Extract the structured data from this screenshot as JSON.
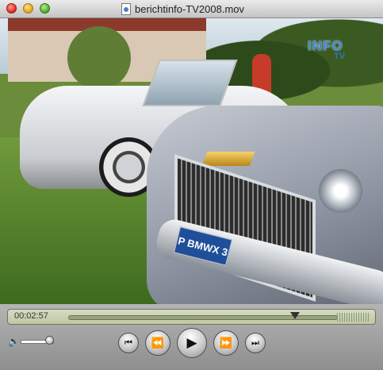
{
  "window": {
    "title": "berichtinfo-TV2008.mov"
  },
  "video": {
    "logo": "INFO",
    "logo_sub": "TV",
    "plate": "P BMWX 3"
  },
  "controls": {
    "timecode": "00:02:57",
    "playback_progress": 0.84,
    "volume_level": 0.9,
    "buttons": {
      "skip_back": "⏮",
      "rewind": "⏪",
      "play": "▶",
      "fast_forward": "⏩",
      "skip_forward": "⏭"
    },
    "speaker_icon": "🔈"
  }
}
